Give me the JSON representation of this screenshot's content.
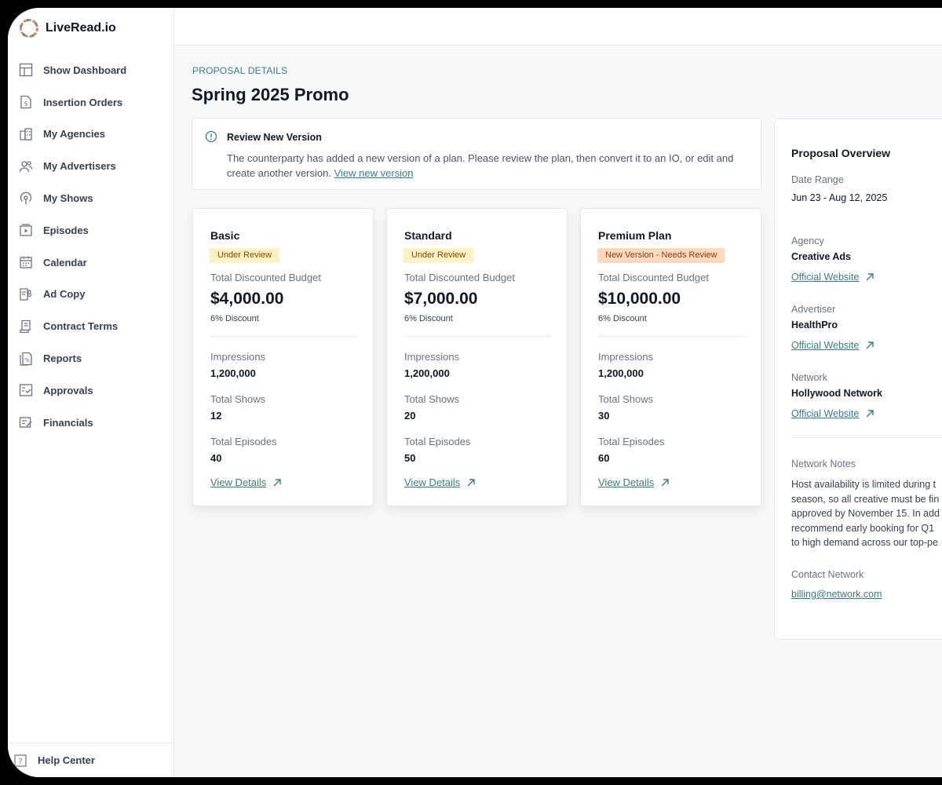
{
  "app": {
    "name": "LiveRead.io"
  },
  "sidebar": {
    "items": [
      {
        "label": "Show Dashboard",
        "icon": "layout-icon"
      },
      {
        "label": "Insertion Orders",
        "icon": "invoice-icon"
      },
      {
        "label": "My Agencies",
        "icon": "building-icon"
      },
      {
        "label": "My Advertisers",
        "icon": "users-icon"
      },
      {
        "label": "My Shows",
        "icon": "podcast-icon"
      },
      {
        "label": "Episodes",
        "icon": "play-icon"
      },
      {
        "label": "Calendar",
        "icon": "calendar-icon"
      },
      {
        "label": "Ad Copy",
        "icon": "ad-copy-icon"
      },
      {
        "label": "Contract Terms",
        "icon": "contract-icon"
      },
      {
        "label": "Reports",
        "icon": "report-icon"
      },
      {
        "label": "Approvals",
        "icon": "approvals-icon"
      },
      {
        "label": "Financials",
        "icon": "financials-icon"
      }
    ],
    "help": {
      "label": "Help Center",
      "icon": "help-icon"
    }
  },
  "main": {
    "eyebrow": "PROPOSAL DETAILS",
    "title": "Spring 2025 Promo",
    "alert": {
      "title": "Review New Version",
      "body": "The counterparty has added a new version of a plan. Please review the plan, then convert it to an IO, or edit and create another version.",
      "link": "View new version"
    },
    "plans": [
      {
        "name": "Basic",
        "badge": "Under Review",
        "budget_label": "Total Discounted Budget",
        "amount": "$4,000.00",
        "discount": "6% Discount",
        "impressions_label": "Impressions",
        "impressions": "1,200,000",
        "shows_label": "Total Shows",
        "shows": "12",
        "episodes_label": "Total Episodes",
        "episodes": "40",
        "details_label": "View Details"
      },
      {
        "name": "Standard",
        "badge": "Under Review",
        "budget_label": "Total Discounted Budget",
        "amount": "$7,000.00",
        "discount": "6% Discount",
        "impressions_label": "Impressions",
        "impressions": "1,200,000",
        "shows_label": "Total Shows",
        "shows": "20",
        "episodes_label": "Total Episodes",
        "episodes": "50",
        "details_label": "View Details"
      },
      {
        "name": "Premium Plan",
        "badge": "New Version - Needs Review",
        "budget_label": "Total Discounted Budget",
        "amount": "$10,000.00",
        "discount": "6% Discount",
        "impressions_label": "Impressions",
        "impressions": "1,200,000",
        "shows_label": "Total Shows",
        "shows": "30",
        "episodes_label": "Total Episodes",
        "episodes": "60",
        "details_label": "View Details"
      }
    ]
  },
  "overview": {
    "title": "Proposal Overview",
    "date_range_label": "Date Range",
    "date_range": "Jun 23 - Aug 12, 2025",
    "agency_label": "Agency",
    "agency": "Creative Ads",
    "agency_link": "Official Website",
    "advertiser_label": "Advertiser",
    "advertiser": "HealthPro",
    "advertiser_link": "Official Website",
    "network_label": "Network",
    "network": "Hollywood Network",
    "network_link": "Official Website",
    "notes_label": "Network Notes",
    "notes": "Host availability is limited during t\nseason, so all creative must be fin\napproved by November 15. In add\nrecommend early booking for Q1\nto high demand across our top-pe",
    "contact_label": "Contact Network",
    "contact_email": "billing@network.com"
  },
  "colors": {
    "accent": "#3b7c86",
    "badge_review_bg": "#fdf0c4",
    "badge_needs_bg": "#fdd9bd",
    "page_bg": "#f7f8fa"
  }
}
